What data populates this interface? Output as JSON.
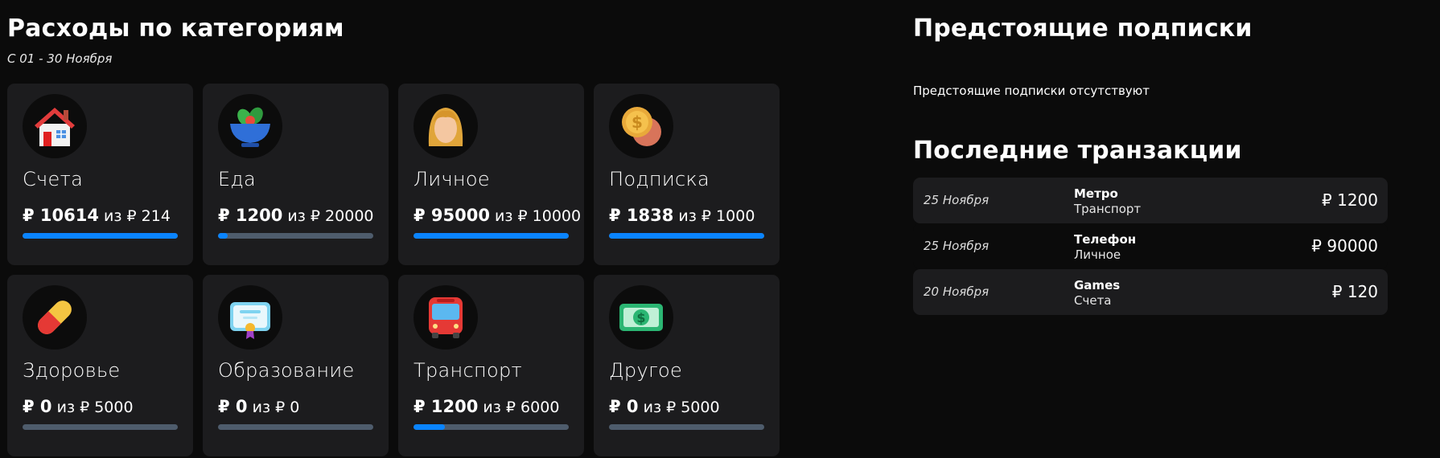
{
  "categories_section": {
    "title": "Расходы по категориям",
    "period": "С 01 - 30 Ноября",
    "currency_symbol": "₽",
    "of_word": "из",
    "cards": [
      {
        "name": "Счета",
        "spent": "₽ 10614",
        "budget": "₽ 214",
        "progress": 1.0,
        "icon": "house-icon"
      },
      {
        "name": "Еда",
        "spent": "₽ 1200",
        "budget": "₽ 20000",
        "progress": 0.06,
        "icon": "salad-bowl-icon"
      },
      {
        "name": "Личное",
        "spent": "₽ 95000",
        "budget": "₽ 10000",
        "progress": 1.0,
        "icon": "person-icon"
      },
      {
        "name": "Подписка",
        "spent": "₽ 1838",
        "budget": "₽ 1000",
        "progress": 1.0,
        "icon": "coins-icon"
      },
      {
        "name": "Здоровье",
        "spent": "₽ 0",
        "budget": "₽ 5000",
        "progress": 0.0,
        "icon": "pill-icon"
      },
      {
        "name": "Образование",
        "spent": "₽ 0",
        "budget": "₽ 0",
        "progress": 0.0,
        "icon": "certificate-icon"
      },
      {
        "name": "Транспорт",
        "spent": "₽ 1200",
        "budget": "₽ 6000",
        "progress": 0.2,
        "icon": "bus-icon"
      },
      {
        "name": "Другое",
        "spent": "₽ 0",
        "budget": "₽ 5000",
        "progress": 0.0,
        "icon": "banknote-icon"
      }
    ]
  },
  "subscriptions_section": {
    "title": "Предстоящие подписки",
    "empty_text": "Предстоящие подписки отсутствуют"
  },
  "transactions_section": {
    "title": "Последние транзакции",
    "items": [
      {
        "date": "25 Ноября",
        "title": "Метро",
        "category": "Транспорт",
        "amount": "₽ 1200"
      },
      {
        "date": "25 Ноября",
        "title": "Телефон",
        "category": "Личное",
        "amount": "₽ 90000"
      },
      {
        "date": "20 Ноября",
        "title": "Games",
        "category": "Счета",
        "amount": "₽ 120"
      }
    ]
  },
  "colors": {
    "background": "#0b0b0b",
    "card": "#1c1c1e",
    "progress_fill": "#0a84ff",
    "progress_track": "#4e5c6c"
  }
}
